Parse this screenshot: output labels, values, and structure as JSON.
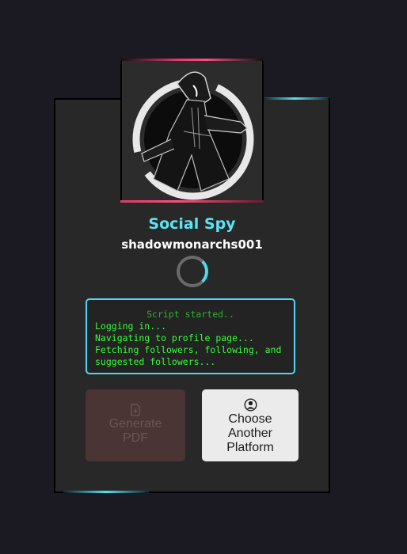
{
  "app": {
    "title": "Social Spy",
    "username": "shadowmonarchs001"
  },
  "log": {
    "header": "Script started..",
    "lines": [
      "Logging in...",
      "Navigating to profile page...",
      "Fetching followers, following, and",
      "suggested followers..."
    ]
  },
  "buttons": {
    "generate_pdf": "Generate PDF",
    "choose_platform": "Choose Another Platform"
  },
  "colors": {
    "accent_cyan": "#5de3f2",
    "accent_pink": "#ff4d7d",
    "log_green": "#37ff37"
  },
  "icons": {
    "pdf": "file-download-icon",
    "platform": "user-circle-icon"
  }
}
